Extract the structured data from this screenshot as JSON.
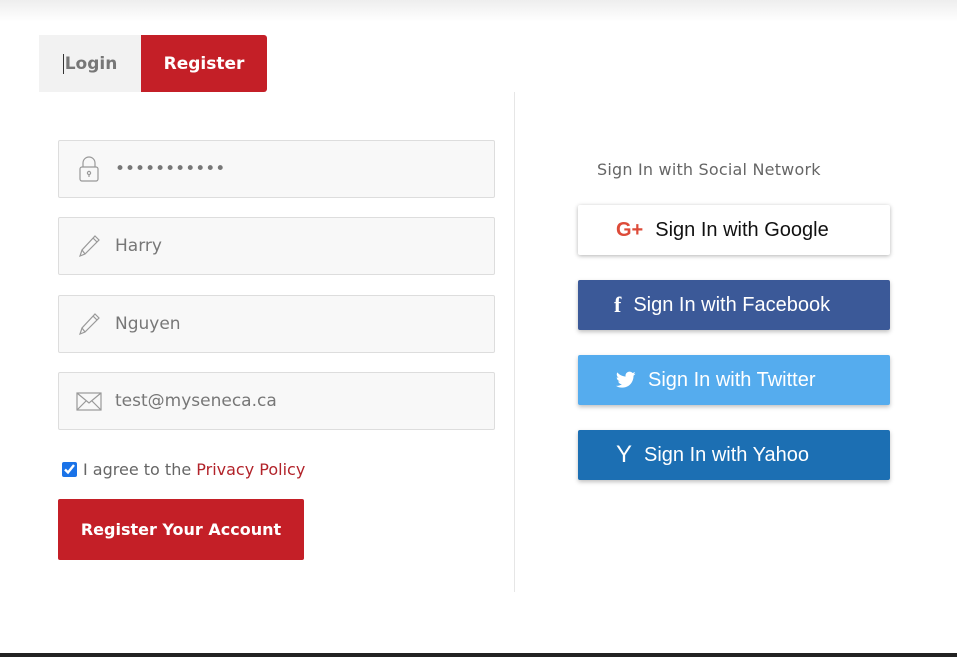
{
  "tabs": {
    "login": "Login",
    "register": "Register"
  },
  "form": {
    "password": {
      "value": "•••••••••••",
      "icon": "lock-icon"
    },
    "first_name": {
      "value": "Harry",
      "icon": "pencil-icon"
    },
    "last_name": {
      "value": "Nguyen",
      "icon": "pencil-icon"
    },
    "email": {
      "value": "test@myseneca.ca",
      "icon": "envelope-icon"
    },
    "agree_text": "I agree to the",
    "privacy_link": "Privacy Policy",
    "agree_checked": true,
    "submit_label": "Register Your Account"
  },
  "social": {
    "title": "Sign In with Social Network",
    "google": {
      "label": "Sign In with Google",
      "glyph": "G+",
      "color": "#dd4b39"
    },
    "facebook": {
      "label": "Sign In with Facebook",
      "glyph": "f",
      "color": "#3b5998"
    },
    "twitter": {
      "label": "Sign In with Twitter",
      "color": "#55acee"
    },
    "yahoo": {
      "label": "Sign In with Yahoo",
      "glyph": "Y",
      "color": "#1c6fb3"
    }
  },
  "colors": {
    "accent": "#c41f27",
    "link": "#b2232a"
  }
}
